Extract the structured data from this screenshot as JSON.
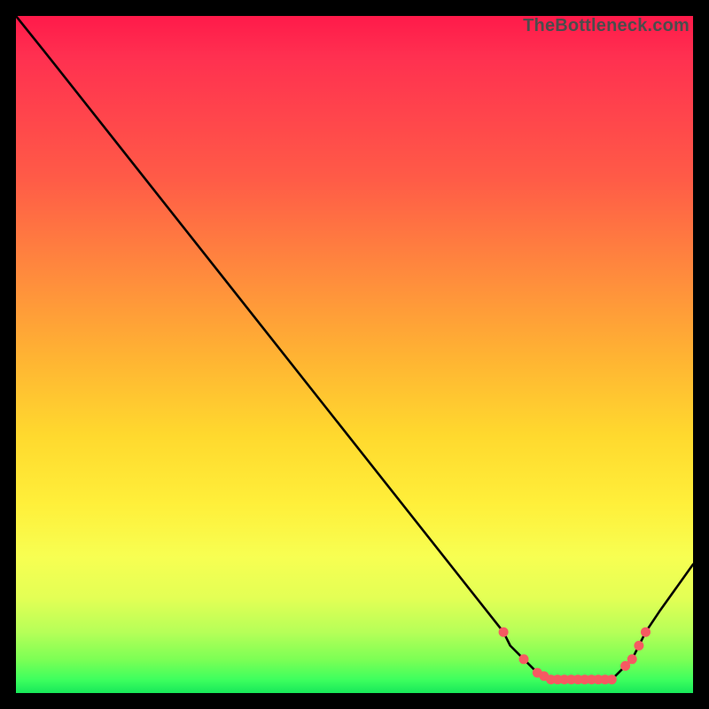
{
  "attribution": "TheBottleneck.com",
  "chart_data": {
    "type": "line",
    "title": "",
    "xlabel": "",
    "ylabel": "",
    "xlim": [
      0,
      100
    ],
    "ylim": [
      0,
      100
    ],
    "series": [
      {
        "name": "bottleneck-curve",
        "x": [
          0,
          4,
          6,
          72,
          73,
          75,
          77,
          79,
          80,
          81,
          83,
          85,
          87,
          88,
          89,
          91,
          92,
          93,
          95,
          100
        ],
        "values": [
          100,
          95,
          92.5,
          9,
          7,
          5,
          3,
          2,
          2,
          2,
          2,
          2,
          2,
          2,
          3,
          5,
          7,
          9,
          12,
          19
        ],
        "stroke": "#000000"
      }
    ],
    "markers": {
      "name": "highlighted-range",
      "color": "#f55a62",
      "radius": 5.5,
      "points": [
        {
          "x": 72,
          "y": 9
        },
        {
          "x": 75,
          "y": 5
        },
        {
          "x": 77,
          "y": 3
        },
        {
          "x": 78,
          "y": 2.5
        },
        {
          "x": 79,
          "y": 2
        },
        {
          "x": 80,
          "y": 2
        },
        {
          "x": 81,
          "y": 2
        },
        {
          "x": 82,
          "y": 2
        },
        {
          "x": 83,
          "y": 2
        },
        {
          "x": 84,
          "y": 2
        },
        {
          "x": 85,
          "y": 2
        },
        {
          "x": 86,
          "y": 2
        },
        {
          "x": 87,
          "y": 2
        },
        {
          "x": 88,
          "y": 2
        },
        {
          "x": 90,
          "y": 4
        },
        {
          "x": 91,
          "y": 5
        },
        {
          "x": 92,
          "y": 7
        },
        {
          "x": 93,
          "y": 9
        }
      ]
    },
    "gradient_stops": [
      {
        "pos": 0,
        "color": "#ff1a4a"
      },
      {
        "pos": 6,
        "color": "#ff3050"
      },
      {
        "pos": 24,
        "color": "#ff5b47"
      },
      {
        "pos": 38,
        "color": "#ff8a3d"
      },
      {
        "pos": 50,
        "color": "#ffb233"
      },
      {
        "pos": 62,
        "color": "#ffd92e"
      },
      {
        "pos": 72,
        "color": "#ffef3a"
      },
      {
        "pos": 80,
        "color": "#f7ff52"
      },
      {
        "pos": 86,
        "color": "#e3ff55"
      },
      {
        "pos": 91,
        "color": "#b6ff58"
      },
      {
        "pos": 95,
        "color": "#7dff55"
      },
      {
        "pos": 98,
        "color": "#3eff5e"
      },
      {
        "pos": 100,
        "color": "#17e85a"
      }
    ]
  }
}
